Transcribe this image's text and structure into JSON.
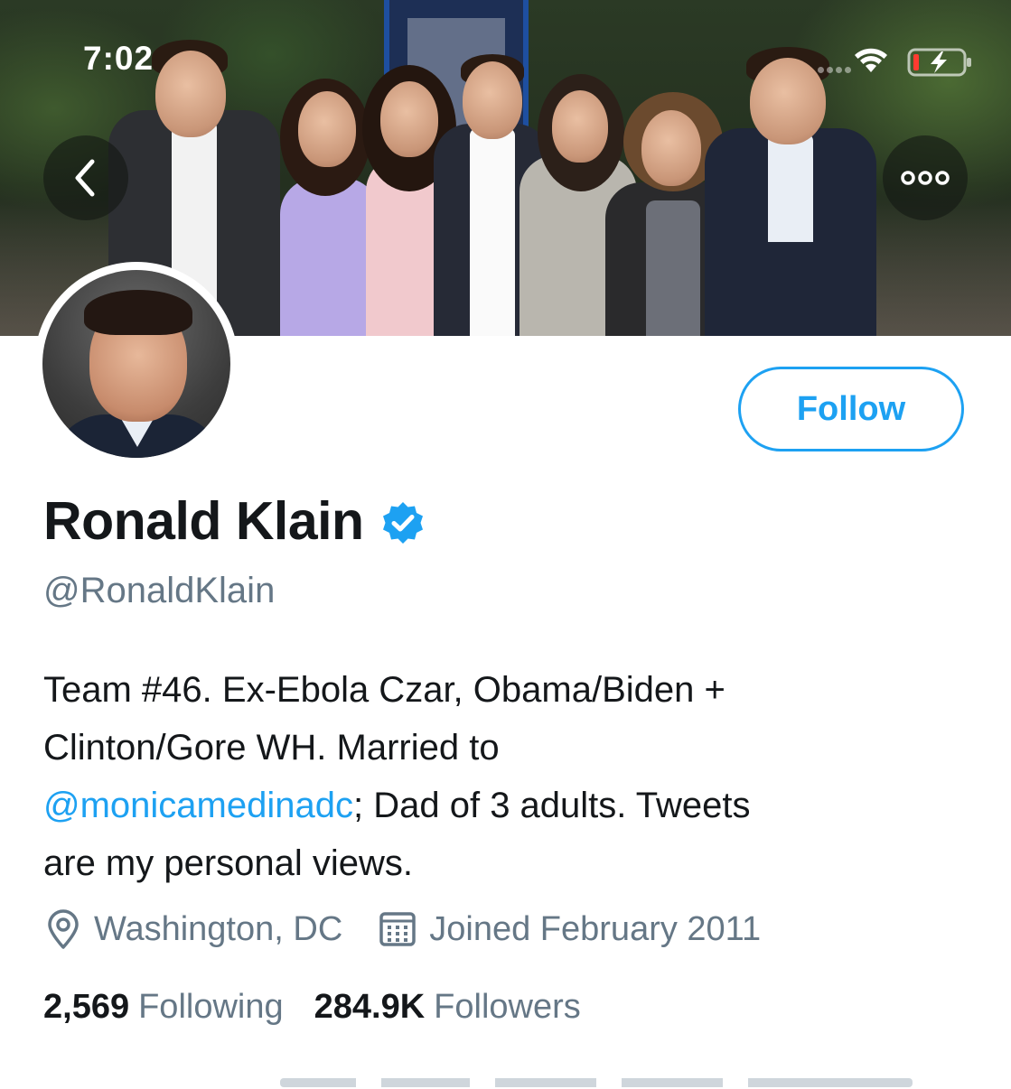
{
  "status_bar": {
    "time": "7:02"
  },
  "banner": {
    "description_icon": "header-photo"
  },
  "profile": {
    "display_name": "Ronald Klain",
    "verified": true,
    "handle": "@RonaldKlain",
    "follow_label": "Follow",
    "bio": {
      "line_1": "Team #46. Ex-Ebola Czar, Obama/Biden +",
      "line_2": "Clinton/Gore WH. Married to",
      "mention": "@monicamedinadc",
      "line_3_rest": "; Dad of 3 adults. Tweets",
      "line_4": "are my personal views."
    },
    "location": "Washington, DC",
    "joined": "Joined February 2011",
    "following_count": "2,569",
    "following_label": "Following",
    "followers_count": "284.9K",
    "followers_label": "Followers"
  },
  "colors": {
    "accent": "#1da1f2",
    "secondary_text": "#657786",
    "primary_text": "#14171a"
  },
  "icons": {
    "back": "chevron-left-icon",
    "more": "more-horizontal-icon",
    "verified": "verified-badge-icon",
    "location": "location-pin-icon",
    "calendar": "calendar-icon",
    "wifi": "wifi-icon",
    "battery": "battery-icon"
  }
}
